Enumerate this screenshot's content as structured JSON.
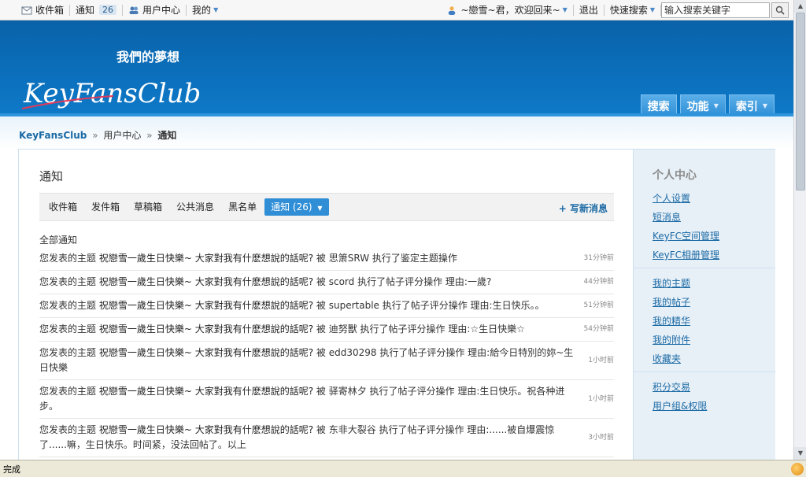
{
  "topbar": {
    "inbox": "收件箱",
    "notify": "通知",
    "notify_count": "26",
    "user_center": "用户中心",
    "mine": "我的",
    "greeting": "~戀雪~君，欢迎回来~",
    "logout": "退出",
    "quick_search": "快速搜索",
    "search_value": "输入搜索关键字"
  },
  "banner": {
    "logo_cn": "我們的夢想",
    "logo_en": "KeyFansClub",
    "nav": [
      "搜索",
      "功能",
      "索引"
    ]
  },
  "breadcrumb": {
    "home": "KeyFansClub",
    "sep": "»",
    "level1": "用户中心",
    "level2": "通知"
  },
  "main": {
    "title": "通知",
    "tabs": [
      "收件箱",
      "发件箱",
      "草稿箱",
      "公共消息",
      "黑名单"
    ],
    "active_tab": "通知 (26)",
    "compose": "+ 写新消息",
    "section": "全部通知"
  },
  "notices": [
    {
      "prefix": "您发表的主题",
      "subject": "祝戀雪一歲生日快樂~ 大家對我有什麽想說的話呢?",
      "detail": "被 思箫SRW 执行了鉴定主题操作",
      "time": "31分钟前"
    },
    {
      "prefix": "您发表的主题",
      "subject": "祝戀雪一歲生日快樂~ 大家對我有什麽想說的話呢?",
      "detail": "被 scord 执行了帖子评分操作 理由:一歲?",
      "time": "44分钟前"
    },
    {
      "prefix": "您发表的主题",
      "subject": "祝戀雪一歲生日快樂~ 大家對我有什麽想說的話呢?",
      "detail": "被 supertable 执行了帖子评分操作 理由:生日快乐。。",
      "time": "51分钟前"
    },
    {
      "prefix": "您发表的主题",
      "subject": "祝戀雪一歲生日快樂~ 大家對我有什麽想說的話呢?",
      "detail": "被 迪努獸 执行了帖子评分操作 理由:☆生日快樂☆",
      "time": "54分钟前"
    },
    {
      "prefix": "您发表的主题",
      "subject": "祝戀雪一歲生日快樂~ 大家對我有什麽想說的話呢?",
      "detail": "被 edd30298 执行了帖子评分操作 理由:給今日特別的妳~生日快樂",
      "time": "1小时前"
    },
    {
      "prefix": "您发表的主题",
      "subject": "祝戀雪一歲生日快樂~ 大家對我有什麽想說的話呢?",
      "detail": "被 驿寄林夕 执行了帖子评分操作 理由:生日快乐。祝各种进步。",
      "time": "1小时前"
    },
    {
      "prefix": "您发表的主题",
      "subject": "祝戀雪一歲生日快樂~ 大家對我有什麽想說的話呢?",
      "detail": "被 东非大裂谷 执行了帖子评分操作 理由:......被自爆震惊了......嘛，生日快乐。时间紧，没法回帖了。以上",
      "time": "3小时前"
    }
  ],
  "sidebar": {
    "title": "个人中心",
    "group1": [
      "个人设置",
      "短消息",
      "KeyFC空间管理",
      "KeyFC相册管理"
    ],
    "group2": [
      "我的主题",
      "我的帖子",
      "我的精华",
      "我的附件",
      "收藏夹"
    ],
    "group3": [
      "积分交易",
      "用户组&权限"
    ]
  },
  "statusbar": {
    "text": "完成"
  },
  "colors": {
    "banner": "#0b70bd",
    "link": "#1b6aa5",
    "active_tab": "#2f8ed6",
    "sidebar_bg": "#e8f0f7"
  }
}
